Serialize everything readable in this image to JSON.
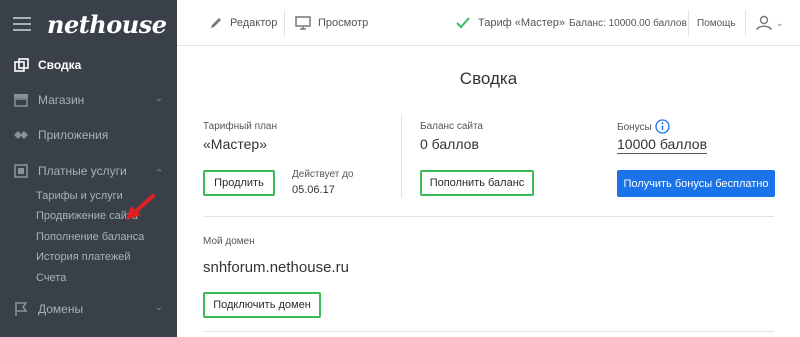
{
  "app": {
    "logo": "nethouse"
  },
  "sidebar": {
    "items": [
      {
        "label": "Сводка",
        "icon": "copy-icon",
        "active": true
      },
      {
        "label": "Магазин",
        "icon": "store-icon"
      },
      {
        "label": "Приложения",
        "icon": "puzzle-icon"
      },
      {
        "label": "Платные услуги",
        "icon": "wallet-icon"
      },
      {
        "label": "Домены",
        "icon": "flag-icon"
      }
    ],
    "paid_sub": [
      "Тарифы и услуги",
      "Продвижение сайта",
      "Пополнение баланса",
      "История платежей",
      "Счета"
    ]
  },
  "topbar": {
    "editor": "Редактор",
    "preview": "Просмотр",
    "tariff": "Тариф «Мастер»",
    "balance": "Баланс: 10000.00 баллов",
    "help": "Помощь"
  },
  "main": {
    "title": "Сводка",
    "plan": {
      "label": "Тарифный план",
      "value": "«Мастер»",
      "button": "Продлить",
      "valid_label": "Действует до",
      "valid_date": "05.06.17"
    },
    "balance": {
      "label": "Баланс сайта",
      "value": "0 баллов",
      "button": "Пополнить баланс"
    },
    "bonus": {
      "label": "Бонусы",
      "value": "10000 баллов",
      "button": "Получить бонусы бесплатно"
    },
    "domain": {
      "label": "Мой домен",
      "value": "snhforum.nethouse.ru",
      "button": "Подключить домен"
    }
  },
  "colors": {
    "sidebar_bg": "#3a4049",
    "green": "#3dbb5a",
    "blue": "#1a73e8",
    "arrow": "#e02020"
  }
}
